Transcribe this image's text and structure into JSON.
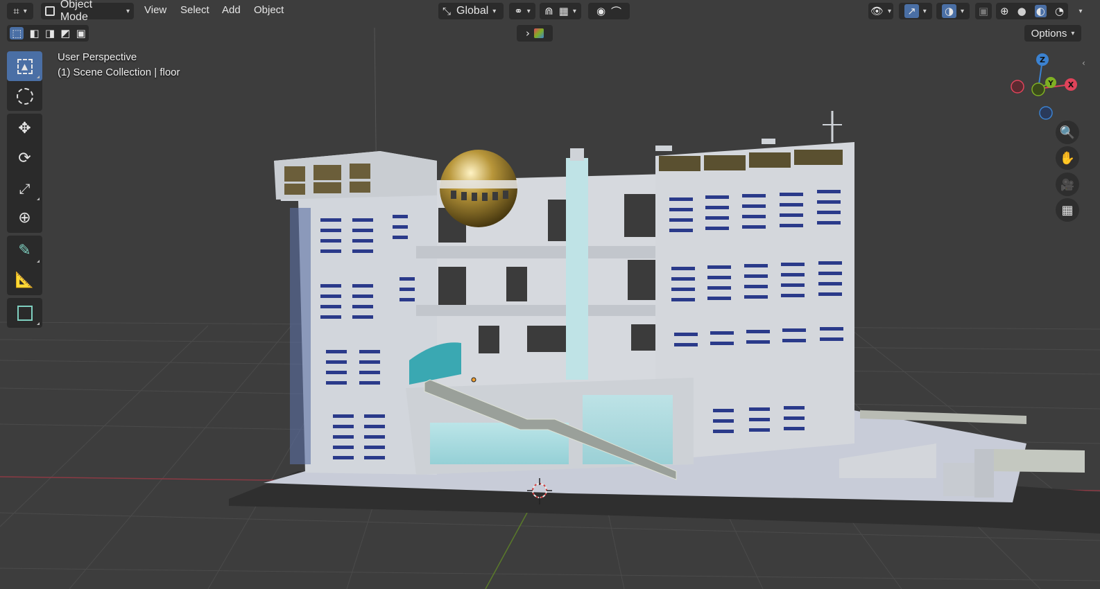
{
  "header": {
    "mode": "Object Mode",
    "menus": [
      "View",
      "Select",
      "Add",
      "Object"
    ],
    "orientation": "Global",
    "options_label": "Options"
  },
  "overlay": {
    "view_name": "User Perspective",
    "collection": "(1) Scene Collection",
    "object": "floor"
  },
  "gizmo": {
    "x": "X",
    "y": "Y",
    "z": "Z"
  },
  "toolbar": {
    "tools": [
      "select-box",
      "cursor",
      "move",
      "rotate",
      "scale",
      "transform",
      "annotate",
      "measure",
      "add-cube"
    ],
    "active": "select-box"
  },
  "navigation": [
    "zoom-icon",
    "hand-pan-icon",
    "camera-icon",
    "grid-icon"
  ],
  "colors": {
    "accent": "#4a6fa5",
    "x_axis": "#e0435a",
    "y_axis": "#7fb023",
    "z_axis": "#3b82d1",
    "background": "#3d3d3d"
  }
}
